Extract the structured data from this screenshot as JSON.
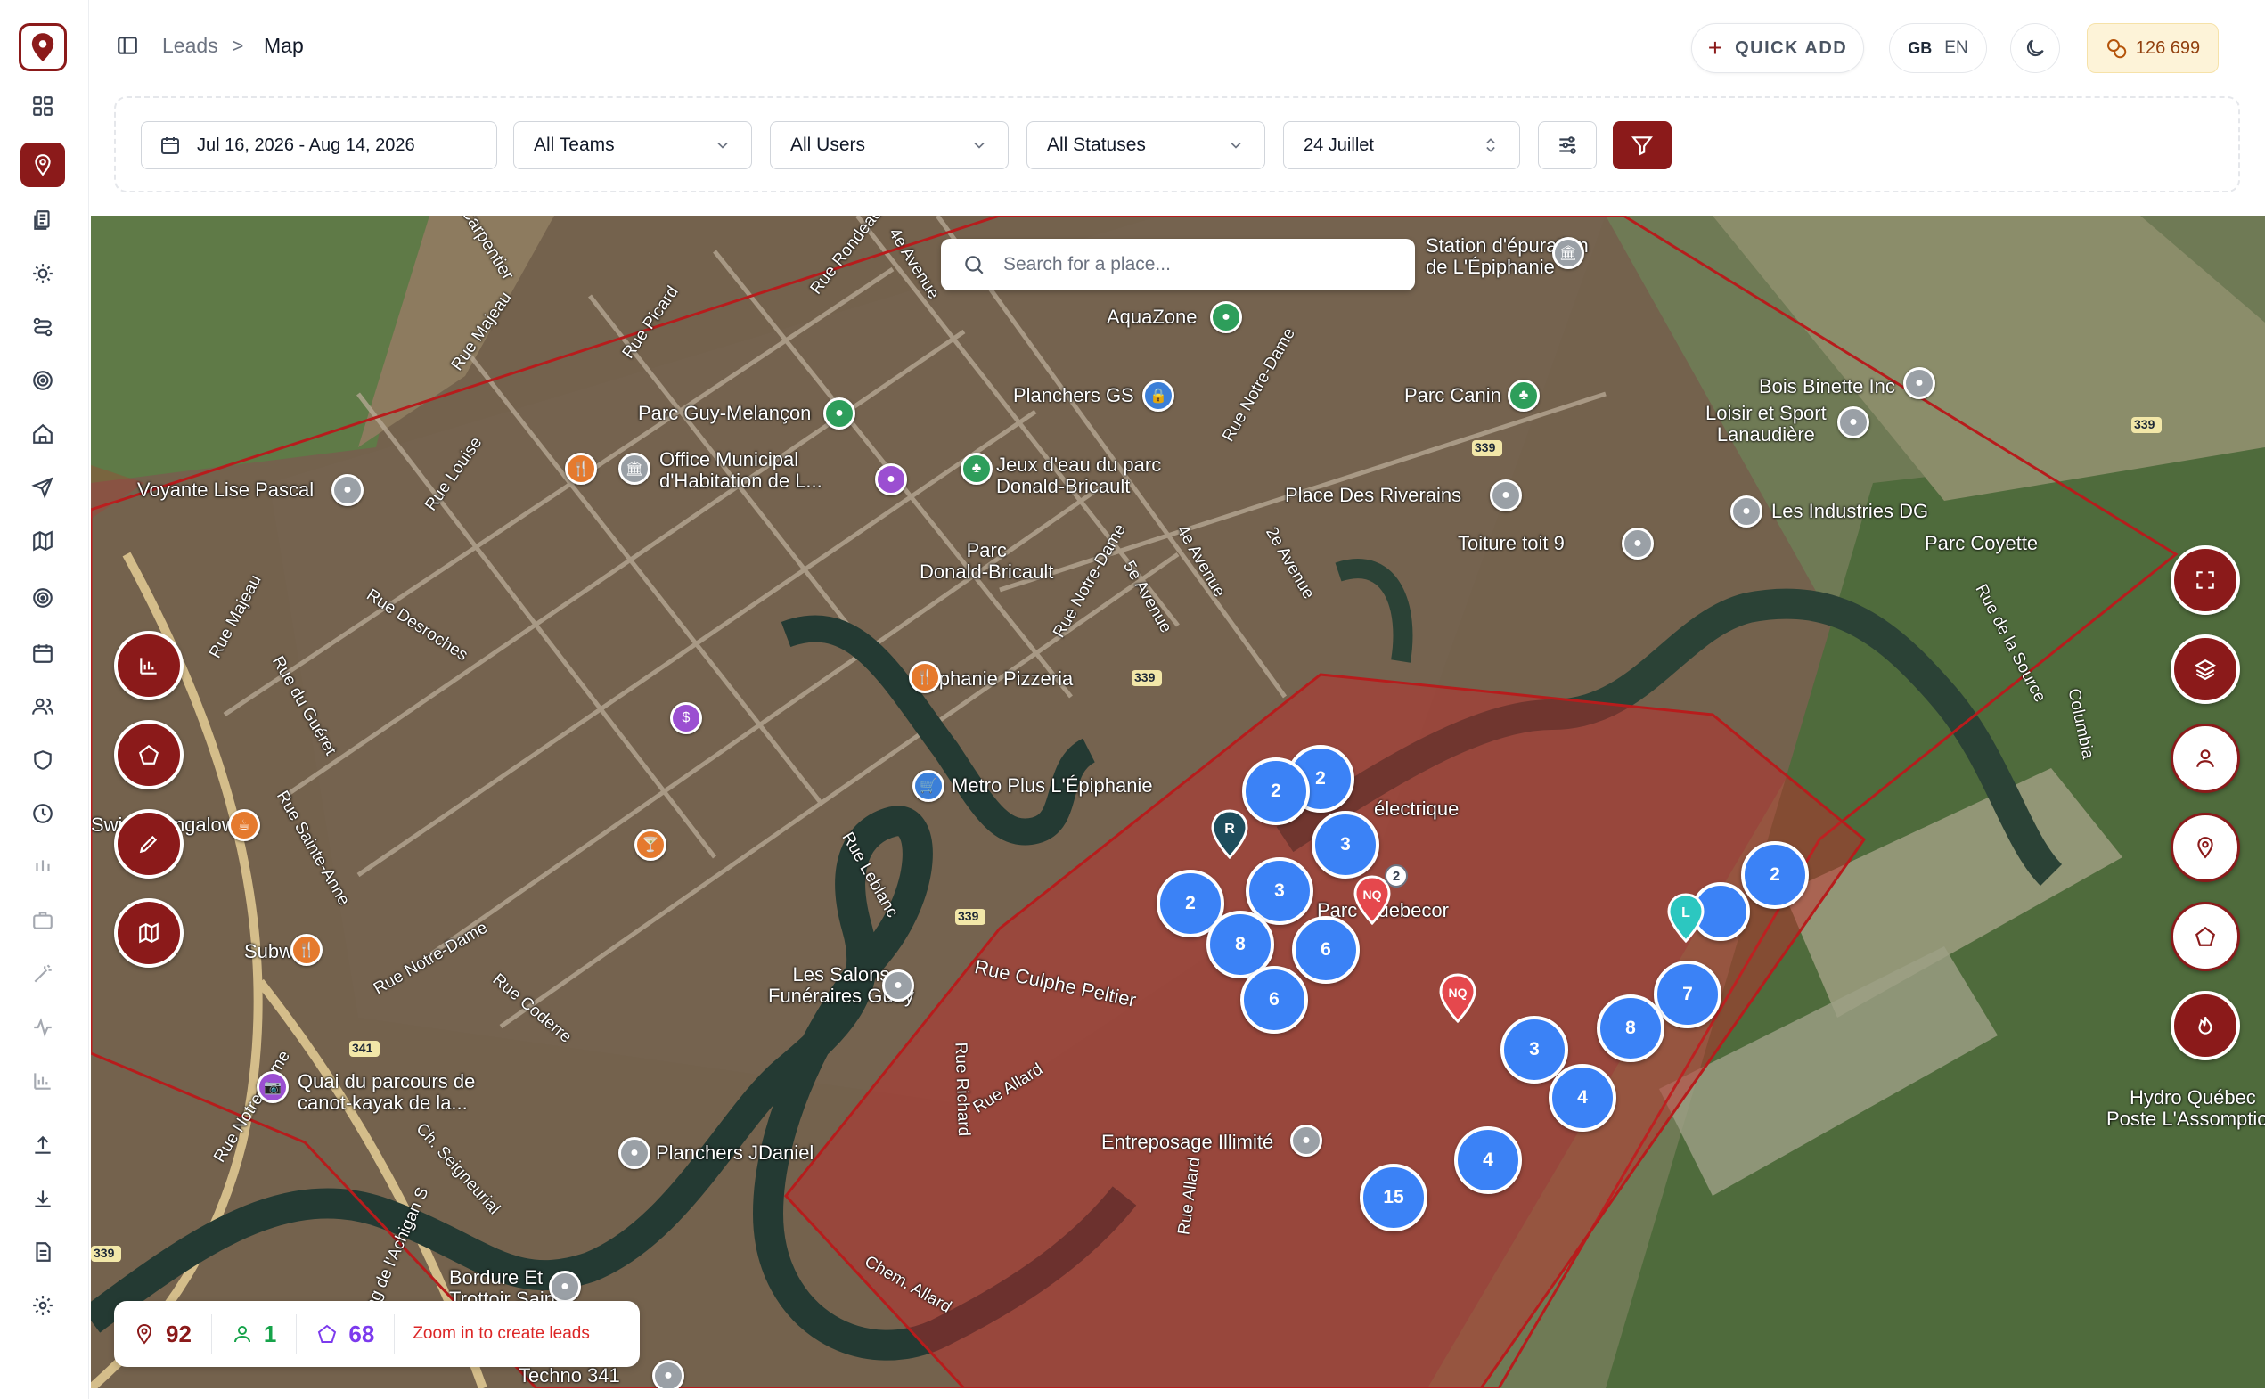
{
  "breadcrumb": {
    "parent": "Leads",
    "separator": ">",
    "current": "Map"
  },
  "header": {
    "quick_add": "QUICK ADD",
    "lang_flag": "GB",
    "lang_code": "EN",
    "credits": "126 699"
  },
  "filters": {
    "date_range": "Jul 16, 2026 - Aug 14, 2026",
    "teams": "All Teams",
    "users": "All Users",
    "statuses": "All Statuses",
    "date_select": "24 Juillet"
  },
  "map": {
    "search_placeholder": "Search for a place...",
    "labels": {
      "carpentier": "Carpentier",
      "rue_rondeau": "Rue Rondeau",
      "ave_4e_top": "4e Avenue",
      "rue_majeau": "Rue Majeau",
      "rue_picard": "Rue Picard",
      "aquazone": "AquaZone",
      "epuration": "Station d'épuration\nde L'Épiphanie",
      "planchers_gs": "Planchers GS",
      "rue_notre_dame_top": "Rue Notre-Dame",
      "parc_canin": "Parc Canin",
      "bois_binette": "Bois Binette Inc",
      "loisir": "Loisir et Sport\nLanaudière",
      "parc_guy": "Parc Guy-Melançon",
      "office": "Office Municipal\nd'Habitation de L...",
      "jeux": "Jeux d'eau du parc\nDonald-Bricault",
      "place_riverains": "Place Des Riverains",
      "industries": "Les Industries DG",
      "voyante": "Voyante Lise Pascal",
      "rue_louise": "Rue Louise",
      "toiture": "Toiture toit 9",
      "parc_coyette": "Parc Coyette",
      "parc_donald": "Parc\nDonald-Bricault",
      "rue_majeau_left": "Rue Majeau",
      "rue_desroches": "Rue Desroches",
      "epiphanie_pizzeria": "Epiphanie Pizzeria",
      "rue_notre_dame_mid": "Rue Notre-Dame",
      "ave_5e": "5e Avenue",
      "ave_4e_mid": "4e Avenue",
      "ave_2e": "2e Avenue",
      "rue_source": "Rue de la Source",
      "columbia": "Columbia",
      "rue_du_gueret": "Rue du Guéret",
      "metro": "Metro Plus L'Épiphanie",
      "electrique": "électrique",
      "swing": "Swing Bungalow",
      "sainte_anne": "Rue Sainte-Anne",
      "parc_quebecor": "Parc Quebecor",
      "subway": "Subway",
      "rue_nd_low": "Rue Notre-Dame",
      "salons": "Les Salons\nFunéraires Guay",
      "culphe": "Rue Culphe Peltier",
      "rue_leblanc": "Rue Leblanc",
      "quai": "Quai du parcours de\ncanot-kayak de la...",
      "hydro": "Hydro Québec\nPoste L'Assomption",
      "rue_allard": "Rue Allard",
      "rue_richard": "Rue Richard",
      "entreposage": "Entreposage Illimité",
      "planchers_jdaniel": "Planchers JDaniel",
      "ch_seigneurial": "Ch. Seigneurial",
      "rang": "Rang de l'Achigan S",
      "bordure": "Bordure Et\nTrottoir Saint...",
      "techno": "Techno 341",
      "chem_allard": "Chem. Allard",
      "rue_coderre": "Rue Coderre",
      "rue_notre_dame_left": "Rue Notre-Dame",
      "rue_allard_low": "Rue Allard"
    },
    "clusters": [
      "2",
      "2",
      "3",
      "3",
      "2",
      "8",
      "6",
      "6",
      "2",
      "7",
      "3",
      "8",
      "4",
      "4",
      "15"
    ],
    "pins": {
      "r": "R",
      "nq": "NQ",
      "nq2": "NQ",
      "l": "L",
      "badge": "2"
    },
    "route_shields": [
      "339",
      "339",
      "339",
      "339",
      "341",
      "339"
    ]
  },
  "stats": {
    "pins": "92",
    "users": "1",
    "areas": "68",
    "hint": "Zoom in to create leads"
  },
  "colors": {
    "brand": "#8b1a1a",
    "cluster": "#3b82f6",
    "polygon_fill": "#c62828",
    "credits_bg": "#fdf3d8"
  }
}
